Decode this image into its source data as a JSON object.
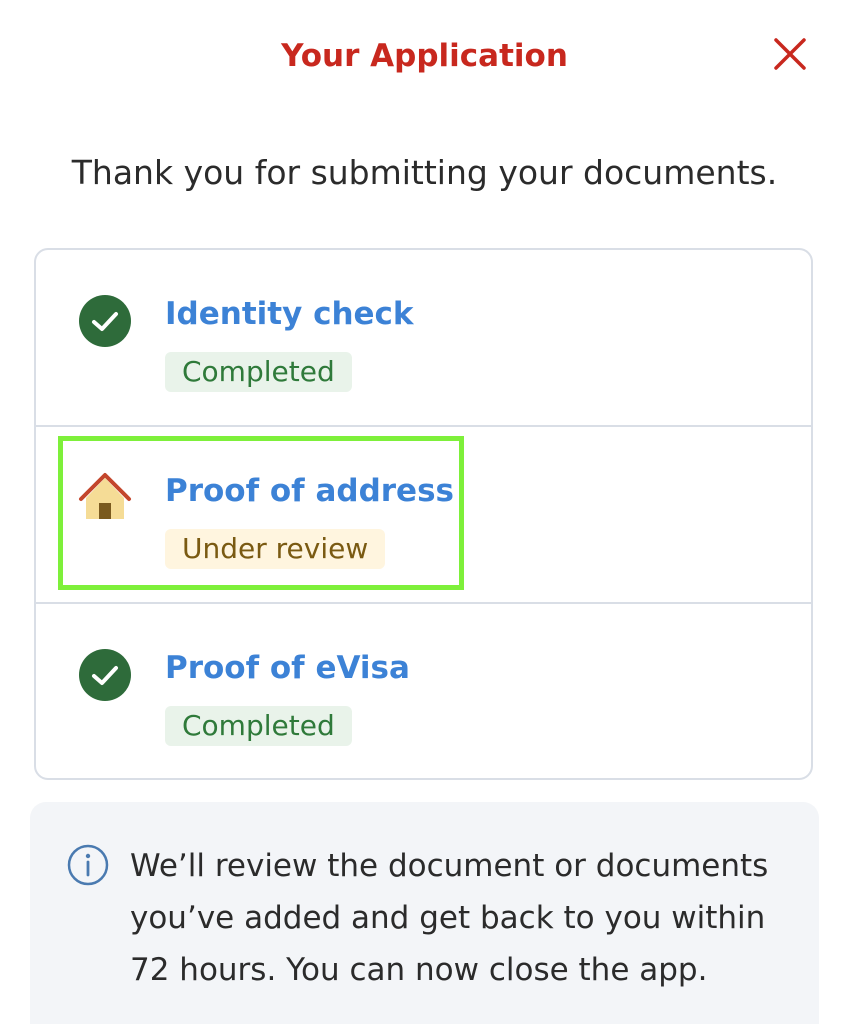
{
  "header": {
    "title": "Your Application",
    "close_icon": "close-icon",
    "accent_color": "#c8281e"
  },
  "intro": "Thank you for submitting your documents.",
  "checks": [
    {
      "title": "Identity check",
      "status": "Completed",
      "icon": "check-circle-icon",
      "status_color": "#2f7a3a"
    },
    {
      "title": "Proof of address",
      "status": "Under review",
      "icon": "house-icon",
      "status_color": "#7a5a12",
      "highlighted": true
    },
    {
      "title": "Proof of eVisa",
      "status": "Completed",
      "icon": "check-circle-icon",
      "status_color": "#2f7a3a"
    }
  ],
  "info": {
    "icon": "info-icon",
    "text": "We’ll review the document or documents you’ve added and get back to you within 72 hours. You can now close the app."
  }
}
